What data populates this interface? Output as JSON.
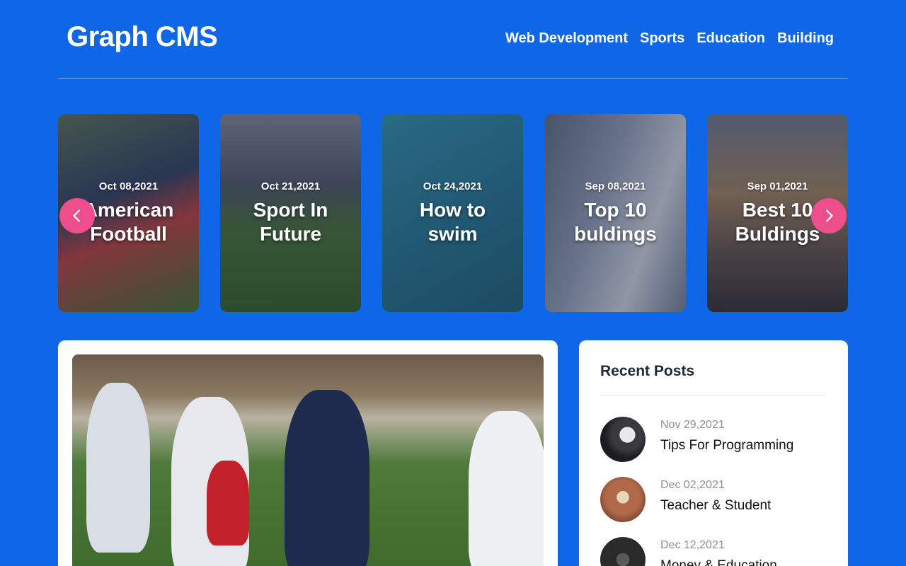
{
  "header": {
    "logo": "Graph CMS",
    "nav": [
      "Web Development",
      "Sports",
      "Education",
      "Building"
    ]
  },
  "carousel": {
    "cards": [
      {
        "date": "Oct 08,2021",
        "title": "American Football"
      },
      {
        "date": "Oct 21,2021",
        "title": "Sport In Future"
      },
      {
        "date": "Oct 24,2021",
        "title": "How to swim"
      },
      {
        "date": "Sep 08,2021",
        "title": "Top 10 buldings"
      },
      {
        "date": "Sep 01,2021",
        "title": "Best 10 Buldings"
      }
    ],
    "prev_icon": "chevron-left-icon",
    "next_icon": "chevron-right-icon"
  },
  "recent_posts": {
    "heading": "Recent Posts",
    "posts": [
      {
        "date": "Nov 29,2021",
        "title": "Tips For Programming"
      },
      {
        "date": "Dec 02,2021",
        "title": "Teacher & Student"
      },
      {
        "date": "Dec 12,2021",
        "title": "Money & Education"
      }
    ]
  },
  "colors": {
    "background": "#0f67e8",
    "accent": "#ec4f8b",
    "card": "#ffffff"
  }
}
